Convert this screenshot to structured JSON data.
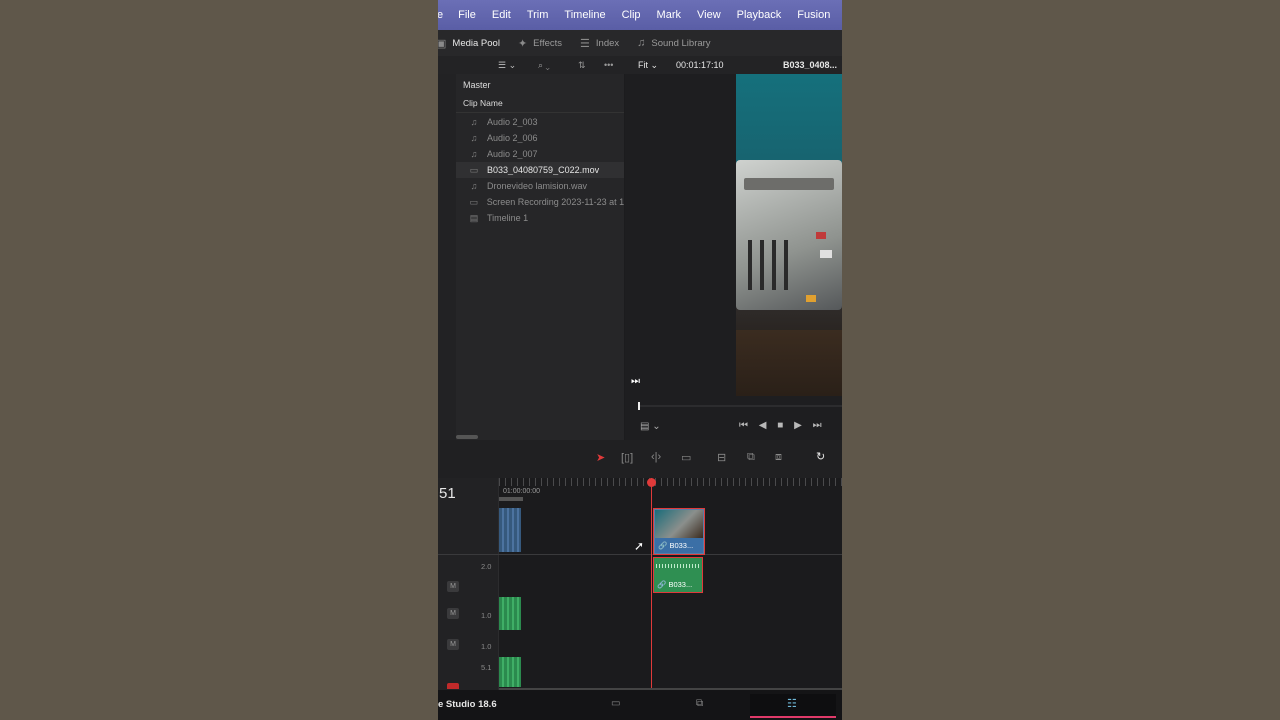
{
  "menu": [
    "e",
    "File",
    "Edit",
    "Trim",
    "Timeline",
    "Clip",
    "Mark",
    "View",
    "Playback",
    "Fusion"
  ],
  "tabs": {
    "media_pool": "Media Pool",
    "effects": "Effects",
    "index": "Index",
    "sound_library": "Sound Library"
  },
  "viewer": {
    "zoom": "Fit",
    "timecode": "00:01:17:10",
    "clip_name": "B033_0408..."
  },
  "pool": {
    "bin": "Master",
    "column_header": "Clip Name",
    "clips": [
      {
        "name": "Audio 2_003",
        "icon": "audio-icon",
        "selected": false
      },
      {
        "name": "Audio 2_006",
        "icon": "audio-icon",
        "selected": false
      },
      {
        "name": "Audio 2_007",
        "icon": "audio-icon",
        "selected": false
      },
      {
        "name": "B033_04080759_C022.mov",
        "icon": "video-icon",
        "selected": true
      },
      {
        "name": "Dronevideo lamision.wav",
        "icon": "audio-icon",
        "selected": false
      },
      {
        "name": "Screen Recording 2023-11-23 at 1:",
        "icon": "video-icon",
        "selected": false
      },
      {
        "name": "Timeline 1",
        "icon": "timeline-icon",
        "selected": false
      }
    ]
  },
  "timeline": {
    "timecode_prefix": "51",
    "ruler_start": "01:00:00:00",
    "video_clip_label": "B033...",
    "audio_clip_label": "B033...",
    "track_levels": [
      "2.0",
      "1.0",
      "1.0",
      "5.1"
    ],
    "mute_label": "M"
  },
  "bottom": {
    "app_name": "e Studio 18.6"
  },
  "colors": {
    "accent": "#e03a3a",
    "menubar": "#5a5ea6",
    "audio_clip": "#2f8f52",
    "video_clip": "#3d5f86"
  }
}
